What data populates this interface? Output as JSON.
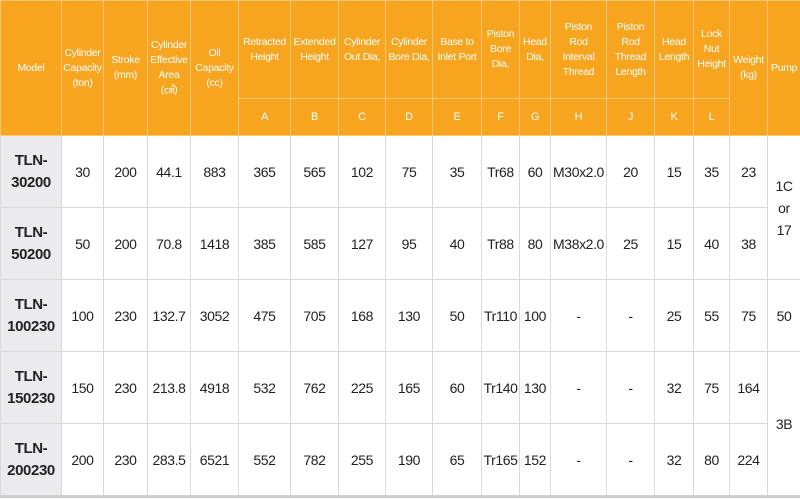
{
  "header_color": "#f7a51f",
  "columns": [
    {
      "label": "Model",
      "letter": null
    },
    {
      "label": "Cylinder\nCapacity\n(ton)",
      "letter": null
    },
    {
      "label": "Stroke\n(mm)",
      "letter": null
    },
    {
      "label": "Cylinder\nEffective\nArea\n(㎠)",
      "letter": null
    },
    {
      "label": "Oil\nCapacity\n(cc)",
      "letter": null
    },
    {
      "label": "Retracted\nHeight",
      "letter": "A"
    },
    {
      "label": "Extended\nHeight",
      "letter": "B"
    },
    {
      "label": "Cylinder\nOut Dia,",
      "letter": "C"
    },
    {
      "label": "Cylinder\nBore Dia,",
      "letter": "D"
    },
    {
      "label": "Base to\nInlet Port",
      "letter": "E"
    },
    {
      "label": "Piston\nBore\nDia,",
      "letter": "F"
    },
    {
      "label": "Head\nDia,",
      "letter": "G"
    },
    {
      "label": "Piston\nRod\nInterval\nThread",
      "letter": "H"
    },
    {
      "label": "Piston\nRod\nThread\nLength",
      "letter": "J"
    },
    {
      "label": "Head\nLength",
      "letter": "K"
    },
    {
      "label": "Lock\nNut\nHeight",
      "letter": "L"
    },
    {
      "label": "Weight\n(kg)",
      "letter": null
    },
    {
      "label": "Pump",
      "letter": null
    }
  ],
  "rows": [
    {
      "model": "TLN-\n30200",
      "values": [
        "30",
        "200",
        "44.1",
        "883",
        "365",
        "565",
        "102",
        "75",
        "35",
        "Tr68",
        "60",
        "M30x2.0",
        "20",
        "15",
        "35",
        "23"
      ]
    },
    {
      "model": "TLN-\n50200",
      "values": [
        "50",
        "200",
        "70.8",
        "1418",
        "385",
        "585",
        "127",
        "95",
        "40",
        "Tr88",
        "80",
        "M38x2.0",
        "25",
        "15",
        "40",
        "38"
      ]
    },
    {
      "model": "TLN-\n100230",
      "values": [
        "100",
        "230",
        "132.7",
        "3052",
        "475",
        "705",
        "168",
        "130",
        "50",
        "Tr110",
        "100",
        "-",
        "-",
        "25",
        "55",
        "75"
      ]
    },
    {
      "model": "TLN-\n150230",
      "values": [
        "150",
        "230",
        "213.8",
        "4918",
        "532",
        "762",
        "225",
        "165",
        "60",
        "Tr140",
        "130",
        "-",
        "-",
        "32",
        "75",
        "164"
      ]
    },
    {
      "model": "TLN-\n200230",
      "values": [
        "200",
        "230",
        "283.5",
        "6521",
        "552",
        "782",
        "255",
        "190",
        "65",
        "Tr165",
        "152",
        "-",
        "-",
        "32",
        "80",
        "224"
      ]
    }
  ],
  "pump_groups": [
    {
      "label": "1C\nor\n17",
      "rows": 2
    },
    {
      "label": "50",
      "rows": 1
    },
    {
      "label": "3B",
      "rows": 2
    }
  ]
}
